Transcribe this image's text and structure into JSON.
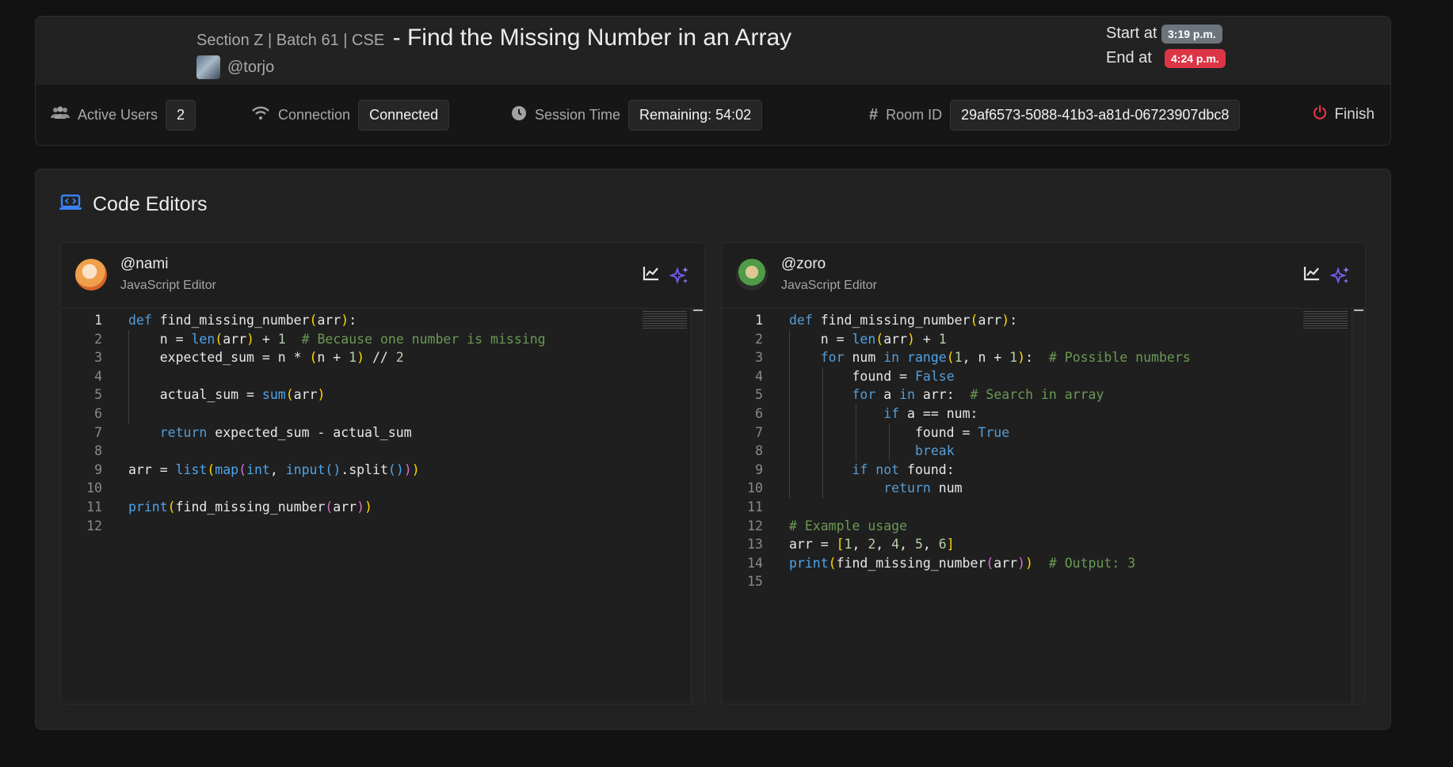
{
  "header": {
    "section_label": "Section Z | Batch 61 | CSE",
    "problem_title": "- Find the Missing Number in an Array",
    "host": "@torjo",
    "start_label": "Start at",
    "start_time": "3:19 p.m.",
    "end_label": "End at",
    "end_time": "4:24 p.m.",
    "colors": {
      "start_badge": "#6c757d",
      "end_badge": "#dc3545"
    }
  },
  "stats": {
    "active_users_label": "Active Users",
    "active_users_value": "2",
    "connection_label": "Connection",
    "connection_value": "Connected",
    "session_label": "Session Time",
    "session_value": "Remaining: 54:02",
    "room_label": "Room ID",
    "room_value": "29af6573-5088-41b3-a81d-06723907dbc8",
    "finish_label": "Finish"
  },
  "editors_section": {
    "title": "Code Editors",
    "icon": "laptop-code-icon"
  },
  "editors": [
    {
      "user": "@nami",
      "type": "JavaScript Editor",
      "icons": [
        "chart-line-icon",
        "sparkles-icon"
      ],
      "active_line": "1",
      "code": [
        "def find_missing_number(arr):",
        "    n = len(arr) + 1  # Because one number is missing",
        "    expected_sum = n * (n + 1) // 2",
        "",
        "    actual_sum = sum(arr)",
        "",
        "    return expected_sum - actual_sum",
        "",
        "arr = list(map(int, input().split()))",
        "",
        "print(find_missing_number(arr))",
        ""
      ]
    },
    {
      "user": "@zoro",
      "type": "JavaScript Editor",
      "icons": [
        "chart-line-icon",
        "sparkles-icon"
      ],
      "active_line": "1",
      "code": [
        "def find_missing_number(arr):",
        "    n = len(arr) + 1",
        "    for num in range(1, n + 1):  # Possible numbers",
        "        found = False",
        "        for a in arr:  # Search in array",
        "            if a == num:",
        "                found = True",
        "                break",
        "        if not found:",
        "            return num",
        "",
        "# Example usage",
        "arr = [1, 2, 4, 5, 6]",
        "print(find_missing_number(arr))  # Output: 3",
        ""
      ]
    }
  ]
}
